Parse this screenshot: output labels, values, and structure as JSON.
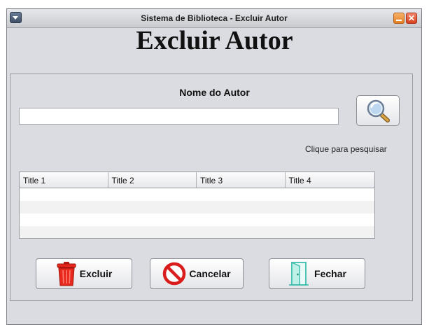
{
  "window": {
    "title": "Sistema de Biblioteca - Excluir Autor"
  },
  "heading": "Excluir Autor",
  "form": {
    "label": "Nome do Autor",
    "input_value": "",
    "hint": "Clique para pesquisar"
  },
  "table": {
    "columns": [
      "Title 1",
      "Title 2",
      "Title 3",
      "Title 4"
    ],
    "rows": [
      [
        "",
        "",
        "",
        ""
      ],
      [
        "",
        "",
        "",
        ""
      ],
      [
        "",
        "",
        "",
        ""
      ],
      [
        "",
        "",
        "",
        ""
      ]
    ]
  },
  "buttons": {
    "excluir": "Excluir",
    "cancelar": "Cancelar",
    "fechar": "Fechar"
  },
  "icons": {
    "window_menu": "window-menu-icon",
    "minimize": "minimize-icon",
    "close": "close-icon",
    "search": "magnifier-icon",
    "delete": "trash-can-icon",
    "cancel": "no-entry-icon",
    "close_door": "door-icon"
  },
  "colors": {
    "window_bg": "#dbdce1",
    "minimize": "#e57e1f",
    "close": "#d8411f",
    "trash": "#e8281c",
    "cancel": "#d91c1c",
    "door": "#3fbfae"
  }
}
